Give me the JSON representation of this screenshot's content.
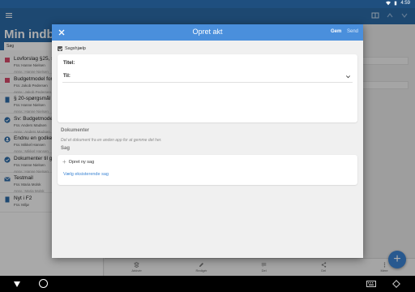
{
  "statusbar": {
    "time": "4:59"
  },
  "left_panel": {
    "title": "Min indbak",
    "search_value": "Søg",
    "items": [
      {
        "title": "Lovforslag §25, sta",
        "from": "Fra: Hanne Nielsen",
        "assignee": "Ansv.: Hanne Nielsen",
        "icon": "red-square-icon"
      },
      {
        "title": "Budgetmodel for",
        "from": "Fra: Jakob Pedersen",
        "assignee": "Ansv.: Jakob Pedersen",
        "icon": "red-square-icon"
      },
      {
        "title": "§ 20-spørgsmål",
        "from": "Fra: Hanne Nielsen",
        "assignee": "Ansv.: Hanne Nielsen",
        "icon": "document-icon"
      },
      {
        "title": "Sv: Budgetmodel",
        "from": "Fra: Anders Madsen",
        "assignee": "Ansv.: Anders Madsen",
        "icon": "check-circle-icon"
      },
      {
        "title": "Endnu en godken",
        "from": "Fra: Mikkel Hansen",
        "assignee": "Ansv.: Mikkel Hansen",
        "icon": "user-circle-icon"
      },
      {
        "title": "Dokumenter til g",
        "from": "Fra: Hanne Nielsen",
        "assignee": "Ansv.: Hanne Nielsen",
        "icon": "check-circle-icon"
      },
      {
        "title": "Testmail",
        "from": "Fra: Maria Molsk",
        "assignee": "Ansv.: Maria Molsk",
        "icon": "mail-icon"
      },
      {
        "title": "Nyt i F2",
        "from": "Fra: Miljø",
        "assignee": "",
        "icon": "document-icon"
      }
    ]
  },
  "bottombar": {
    "items": [
      {
        "label": "Arkivér",
        "icon": "archive-icon"
      },
      {
        "label": "Redigér",
        "icon": "pencil-icon"
      },
      {
        "label": "Del",
        "icon": "comment-icon"
      },
      {
        "label": "Del",
        "icon": "share-icon"
      },
      {
        "label": "Mere",
        "icon": "more-icon"
      }
    ]
  },
  "dialog": {
    "title": "Opret akt",
    "save_label": "Gem",
    "send_label": "Send",
    "sagshjaelp_label": "Sagshjælp",
    "sagshjaelp_checked": true,
    "title_label": "Titel:",
    "to_label": "Til:",
    "documents_label": "Dokumenter",
    "documents_hint": "Del et dokument fra en anden app for at gemme det her.",
    "sag_label": "Sag",
    "create_case_label": "Opret ny sag",
    "select_case_label": "Vælg eksisterende sag"
  },
  "colors": {
    "appbar": "#2c6aa7",
    "dialog_header": "#4a8fdc",
    "link": "#3b84d3",
    "fab": "#3b84d3"
  }
}
